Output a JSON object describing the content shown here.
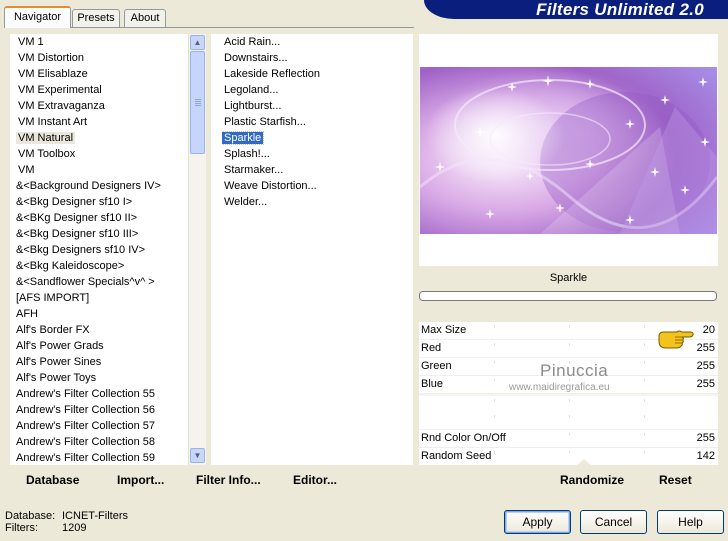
{
  "tabs": [
    {
      "label": "Navigator"
    },
    {
      "label": "Presets"
    },
    {
      "label": "About"
    }
  ],
  "app_title": "Filters Unlimited 2.0",
  "categories": [
    "VM 1",
    "VM Distortion",
    "VM Elisablaze",
    "VM Experimental",
    "VM Extravaganza",
    "VM Instant Art",
    "VM Natural",
    "VM Toolbox",
    "VM",
    "&<Background Designers IV>",
    "&<Bkg Designer sf10 I>",
    "&<BKg Designer sf10 II>",
    "&<Bkg Designer sf10 III>",
    "&<Bkg Designers sf10 IV>",
    "&<Bkg Kaleidoscope>",
    "&<Sandflower Specials^v^ >",
    "[AFS IMPORT]",
    "AFH",
    "Alf's Border FX",
    "Alf's Power Grads",
    "Alf's Power Sines",
    "Alf's Power Toys",
    "Andrew's Filter Collection 55",
    "Andrew's Filter Collection 56",
    "Andrew's Filter Collection 57",
    "Andrew's Filter Collection 58",
    "Andrew's Filter Collection 59"
  ],
  "selected_category": "VM Natural",
  "filters": [
    "Acid Rain...",
    "Downstairs...",
    "Lakeside Reflection",
    "Legoland...",
    "Lightburst...",
    "Plastic Starfish...",
    "Sparkle",
    "Splash!...",
    "Starmaker...",
    "Weave Distortion...",
    "Welder..."
  ],
  "selected_filter": "Sparkle",
  "list_footer": {
    "database": "Database",
    "import": "Import...",
    "filter_info": "Filter Info...",
    "editor": "Editor..."
  },
  "preview": {
    "filter_name": "Sparkle",
    "progress": 0
  },
  "watermark": {
    "name": "Pinuccia",
    "url": "www.maidiregrafica.eu"
  },
  "parameters": [
    {
      "label": "Max Size",
      "value": "20"
    },
    {
      "label": "Red",
      "value": "255"
    },
    {
      "label": "Green",
      "value": "255"
    },
    {
      "label": "Blue",
      "value": "255"
    },
    {
      "label": "",
      "value": ""
    },
    {
      "label": "",
      "value": ""
    },
    {
      "label": "Rnd Color On/Off",
      "value": "255"
    },
    {
      "label": "Random Seed",
      "value": "142"
    }
  ],
  "param_footer": {
    "randomize": "Randomize",
    "reset": "Reset"
  },
  "status": {
    "database_label": "Database:",
    "database_value": "ICNET-Filters",
    "filters_label": "Filters:",
    "filters_value": "1209"
  },
  "buttons": {
    "apply": "Apply",
    "cancel": "Cancel",
    "help": "Help"
  },
  "colors": {
    "window_bg": "#ece9d8",
    "title_banner": "#0a1f7d",
    "selection": "#316ac5"
  },
  "icons": {
    "scroll_up": "chevron-up-icon",
    "scroll_down": "chevron-down-icon",
    "pointer": "pointing-hand-icon"
  }
}
